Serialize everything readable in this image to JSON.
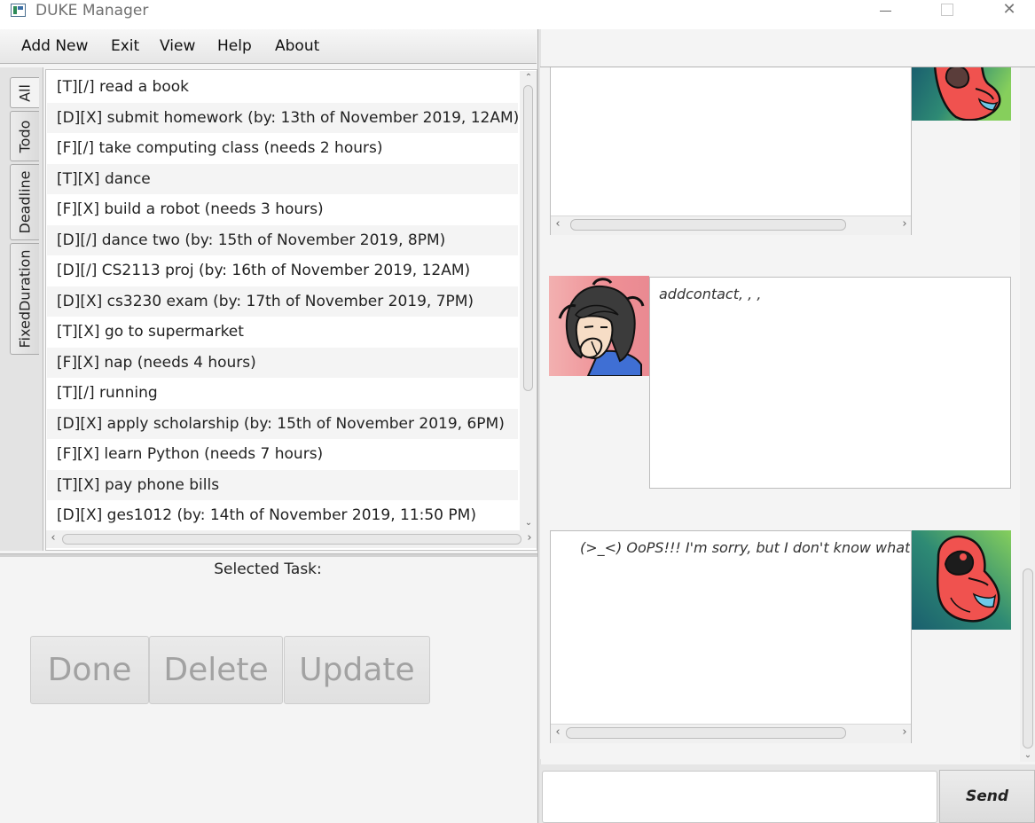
{
  "window": {
    "title": "DUKE Manager",
    "icon": "app-window-icon",
    "close_glyph": "✕"
  },
  "menu": [
    "Add New",
    "Exit",
    "View",
    "Help",
    "About"
  ],
  "tabs": [
    "All",
    "Todo",
    "Deadline",
    "FixedDuration"
  ],
  "tasks": [
    "[T][/] read a book",
    "[D][X] submit homework (by: 13th of November 2019, 12AM)",
    "[F][/] take computing class (needs 2 hours)",
    "[T][X] dance",
    "[F][X] build a robot (needs 3 hours)",
    "[D][/] dance two (by: 15th of November 2019, 8PM)",
    "[D][/] CS2113 proj (by: 16th of November 2019, 12AM)",
    "[D][X] cs3230 exam (by: 17th of November 2019, 7PM)",
    "[T][X] go to supermarket",
    "[F][X] nap (needs 4 hours)",
    "[T][/] running",
    "[D][X] apply scholarship (by: 15th of November 2019, 6PM)",
    "[F][X] learn Python (needs 7 hours)",
    "[T][X] pay phone bills",
    "[D][X] ges1012 (by: 14th of November 2019, 11:50 PM)"
  ],
  "selected_task_label": "Selected Task:",
  "actions": {
    "done": "Done",
    "delete": "Delete",
    "update": "Update"
  },
  "chat": {
    "messages": [
      {
        "sender": "duke",
        "text": "",
        "avatar": "duke-bird-avatar"
      },
      {
        "sender": "user",
        "text": "addcontact, , ,",
        "avatar": "user-avatar"
      },
      {
        "sender": "duke",
        "text": "(>_<) OoPS!!! I'm sorry, but I don't know what that r",
        "avatar": "duke-bird-avatar"
      }
    ],
    "input_value": "",
    "send_label": "Send"
  },
  "colors": {
    "bird_body": "#f0524f",
    "bird_bg_dark": "#1d6b73",
    "bird_bg_light": "#7cc95a",
    "user_shirt": "#3f6fd4"
  }
}
